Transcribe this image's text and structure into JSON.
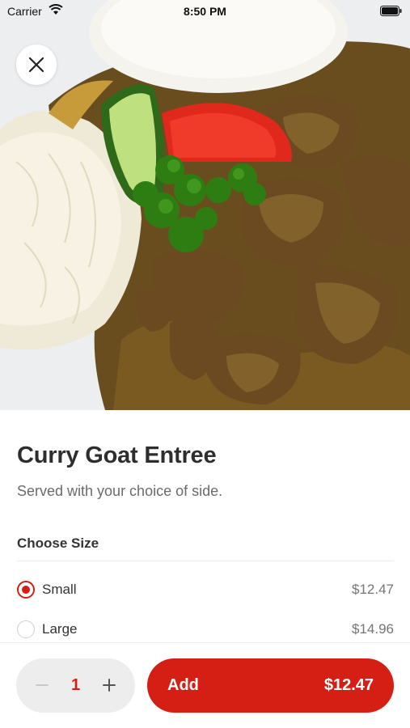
{
  "status_bar": {
    "carrier": "Carrier",
    "time": "8:50 PM",
    "wifi_icon": "wifi-icon",
    "battery_icon": "battery-icon"
  },
  "hero": {
    "icon": "food-photo"
  },
  "close_button": {
    "icon": "close-icon"
  },
  "item": {
    "title": "Curry Goat Entree",
    "description": "Served with your choice of side."
  },
  "size_section": {
    "title": "Choose Size",
    "options": [
      {
        "label": "Small",
        "price": "$12.47",
        "selected": true
      },
      {
        "label": "Large",
        "price": "$14.96",
        "selected": false
      }
    ]
  },
  "bottom_bar": {
    "quantity": "1",
    "minus_icon": "minus-icon",
    "plus_icon": "plus-icon",
    "add_label": "Add",
    "add_price": "$12.47"
  },
  "colors": {
    "accent": "#d61f14",
    "stepper_bg": "#ededed",
    "text_primary": "#2e2e2e",
    "text_secondary": "#6b6b6b"
  }
}
